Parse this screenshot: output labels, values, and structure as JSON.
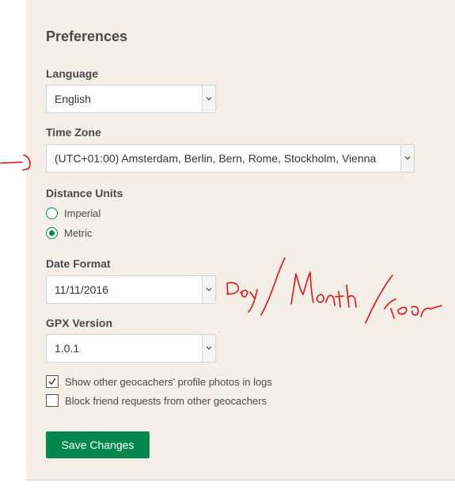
{
  "preferences": {
    "title": "Preferences",
    "language": {
      "label": "Language",
      "value": "English"
    },
    "time_zone": {
      "label": "Time Zone",
      "value": "(UTC+01:00) Amsterdam, Berlin, Bern, Rome, Stockholm, Vienna"
    },
    "distance_units": {
      "label": "Distance Units",
      "options": [
        {
          "label": "Imperial",
          "selected": false
        },
        {
          "label": "Metric",
          "selected": true
        }
      ]
    },
    "date_format": {
      "label": "Date Format",
      "value": "11/11/2016"
    },
    "gpx_version": {
      "label": "GPX Version",
      "value": "1.0.1"
    },
    "checkboxes": [
      {
        "label": "Show other geocachers' profile photos in logs",
        "checked": true
      },
      {
        "label": "Block friend requests from other geocachers",
        "checked": false
      }
    ],
    "save_label": "Save Changes"
  },
  "annotations": {
    "handwritten_text": "Day/Month/Year",
    "ink_color": "#e01010"
  },
  "colors": {
    "accent": "#02874d",
    "panel_bg": "#f5efe7"
  }
}
